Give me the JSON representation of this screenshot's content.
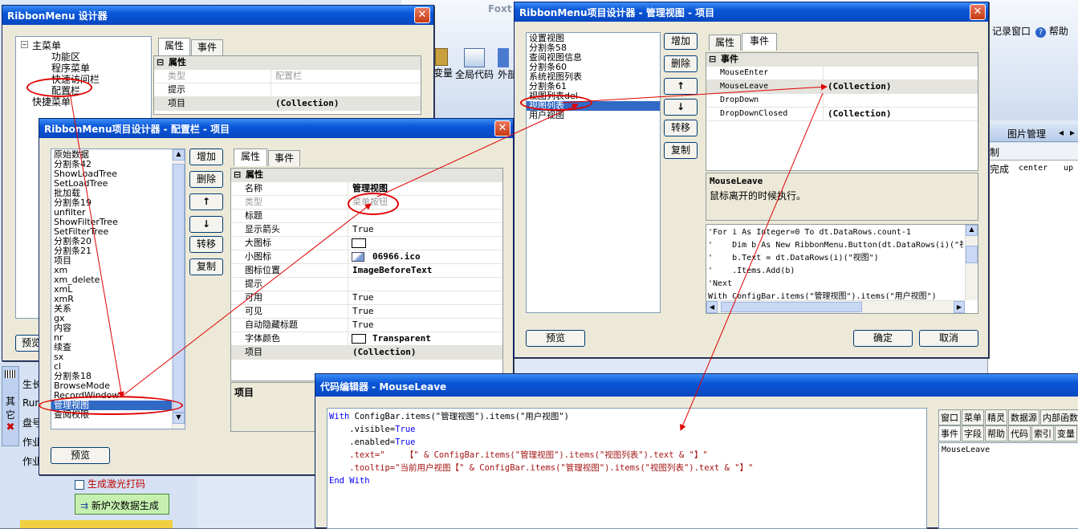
{
  "bg_app": {
    "title_fragment": "Foxt",
    "toolbar": {
      "record_window": "记录窗口",
      "help": "帮助",
      "var_label": "变量",
      "global_code": "全局代码",
      "external": "外部"
    },
    "image_manage": "图片管理",
    "grid_left": "制",
    "grid_done": "完成",
    "grid_center": "center",
    "grid_up": "up",
    "left_items": [
      "生长",
      "Run",
      "盘号",
      "作业",
      "作业"
    ],
    "left_icons": [
      "其",
      "它"
    ],
    "laser_print": "生成激光打码",
    "new_furnace": "新炉次数据生成"
  },
  "win_designer": {
    "title": "RibbonMenu 设计器",
    "tree": [
      "主菜单",
      "功能区",
      "程序菜单",
      "快速访问栏",
      "配置栏",
      "快捷菜单"
    ],
    "tabs": [
      "属性",
      "事件"
    ],
    "group": "属性",
    "rows": [
      {
        "name": "类型",
        "value": "配置栏"
      },
      {
        "name": "提示",
        "value": ""
      },
      {
        "name": "项目",
        "value": "(Collection)"
      }
    ]
  },
  "win_config": {
    "title": "RibbonMenu项目设计器 - 配置栏 - 项目",
    "items": [
      "原始数据",
      "分割条42",
      "ShowLoadTree",
      "SetLoadTree",
      "批加载",
      "分割条19",
      "unfilter",
      "ShowFilterTree",
      "SetFilterTree",
      "分割条20",
      "分割条21",
      "项目",
      "xm",
      "xm_delete",
      "xmL",
      "xmR",
      "关系",
      "gx",
      "内容",
      "nr",
      "续查",
      "sx",
      "cl",
      "分割条18",
      "BrowseMode",
      "RecordWindow",
      "管理视图",
      "查阅权限"
    ],
    "selected_index": 26,
    "buttons": [
      "增加",
      "删除",
      "↑",
      "↓",
      "转移",
      "复制"
    ],
    "tabs": [
      "属性",
      "事件"
    ],
    "group": "属性",
    "rows": [
      {
        "name": "名称",
        "value": "管理视图"
      },
      {
        "name": "类型",
        "value": "菜单按钮"
      },
      {
        "name": "标题",
        "value": ""
      },
      {
        "name": "显示箭头",
        "value": "True"
      },
      {
        "name": "大图标",
        "value": ""
      },
      {
        "name": "小图标",
        "value": "06966.ico"
      },
      {
        "name": "图标位置",
        "value": "ImageBeforeText"
      },
      {
        "name": "提示",
        "value": ""
      },
      {
        "name": "可用",
        "value": "True"
      },
      {
        "name": "可见",
        "value": "True"
      },
      {
        "name": "自动隐藏标题",
        "value": "True"
      },
      {
        "name": "字体颜色",
        "value": "Transparent"
      },
      {
        "name": "项目",
        "value": "(Collection)"
      }
    ],
    "desc_title": "项目",
    "preview": "预览"
  },
  "win_view": {
    "title": "RibbonMenu项目设计器 - 管理视图 - 项目",
    "items": [
      "设置视图",
      "分割条58",
      "查阅视图信息",
      "分割条60",
      "系统视图列表",
      "分割条61",
      "视图列表del",
      "视图列表",
      "用户视图"
    ],
    "selected_index": 7,
    "buttons": [
      "增加",
      "删除",
      "↑",
      "↓",
      "转移",
      "复制"
    ],
    "tabs": [
      "属性",
      "事件"
    ],
    "group": "事件",
    "rows": [
      {
        "name": "MouseEnter",
        "value": ""
      },
      {
        "name": "MouseLeave",
        "value": "(Collection)"
      },
      {
        "name": "DropDown",
        "value": ""
      },
      {
        "name": "DropDownClosed",
        "value": "(Collection)"
      }
    ],
    "desc_title": "MouseLeave",
    "desc_text": "鼠标离开的时候执行。",
    "code_lines": [
      "'For i As Integer=0 To dt.DataRows.count-1",
      "'    Dim b As New RibbonMenu.Button(dt.DataRows(i)(\"视",
      "'    b.Text = dt.DataRows(i)(\"视图\")",
      "'    .Items.Add(b)",
      "'Next",
      "With ConfigBar.items(\"管理视图\").items(\"用户视图\")"
    ],
    "preview": "预览",
    "ok": "确定",
    "cancel": "取消"
  },
  "win_code": {
    "title": "代码编辑器 - MouseLeave",
    "lines": [
      [
        {
          "t": "With",
          "c": "kw"
        },
        {
          "t": " ConfigBar.items(\"管理视图\").items(\"用户视图\")",
          "c": ""
        }
      ],
      [
        {
          "t": "    .visible=",
          "c": ""
        },
        {
          "t": "True",
          "c": "kw"
        }
      ],
      [
        {
          "t": "    .enabled=",
          "c": ""
        },
        {
          "t": "True",
          "c": "kw"
        }
      ],
      [
        {
          "t": "    .text=\"    【\" & ConfigBar.items(\"管理视图\").items(\"视图列表\").text & \"】\"",
          "c": "str"
        }
      ],
      [
        {
          "t": "    .tooltip=\"当前用户视图【\" & ConfigBar.items(\"管理视图\").items(\"视图列表\").text & \"】\"",
          "c": "str"
        }
      ],
      [
        {
          "t": "End With",
          "c": "kw"
        }
      ]
    ],
    "side_tabs_row1": [
      "窗口",
      "菜单",
      "精灵",
      "数据源",
      "内部函数"
    ],
    "side_tabs_row2": [
      "事件",
      "字段",
      "帮助",
      "代码",
      "索引",
      "变量"
    ],
    "side_item": "MouseLeave"
  }
}
